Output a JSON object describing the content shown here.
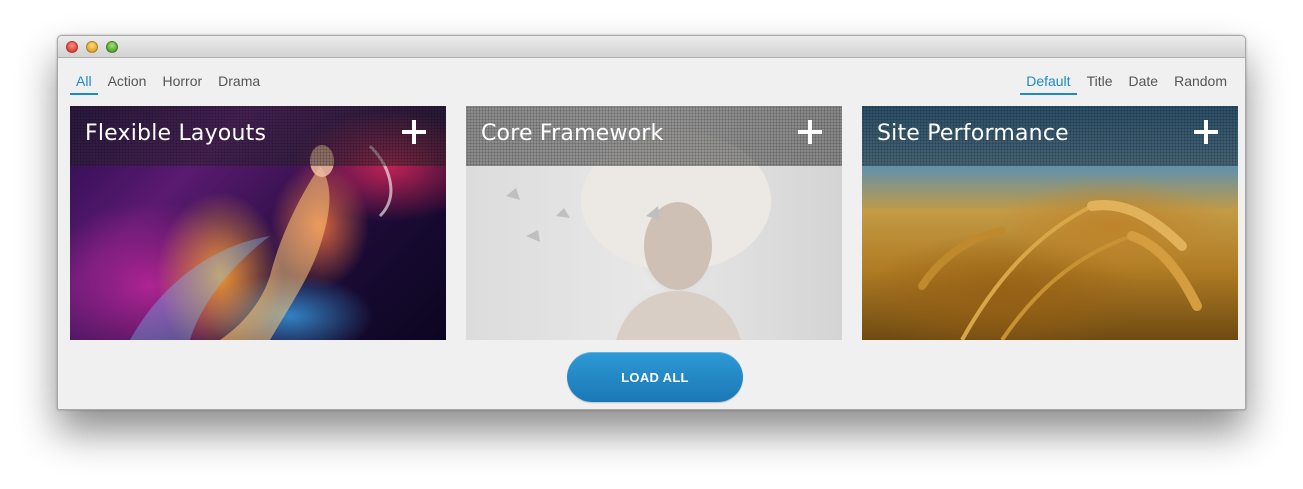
{
  "filters": [
    {
      "label": "All",
      "active": true
    },
    {
      "label": "Action",
      "active": false
    },
    {
      "label": "Horror",
      "active": false
    },
    {
      "label": "Drama",
      "active": false
    }
  ],
  "sorts": [
    {
      "label": "Default",
      "active": true
    },
    {
      "label": "Title",
      "active": false
    },
    {
      "label": "Date",
      "active": false
    },
    {
      "label": "Random",
      "active": false
    }
  ],
  "cards": [
    {
      "title": "Flexible Layouts",
      "image": "dancer-abstract-colorful",
      "icon": "plus-icon"
    },
    {
      "title": "Core Framework",
      "image": "woman-portrait-origami",
      "icon": "plus-icon"
    },
    {
      "title": "Site Performance",
      "image": "wheat-field-closeup",
      "icon": "plus-icon"
    }
  ],
  "load_button": {
    "label": "LOAD ALL"
  },
  "colors": {
    "accent": "#1b8ac8",
    "button": "#2389c6",
    "window_bg": "#f0f0f0"
  }
}
